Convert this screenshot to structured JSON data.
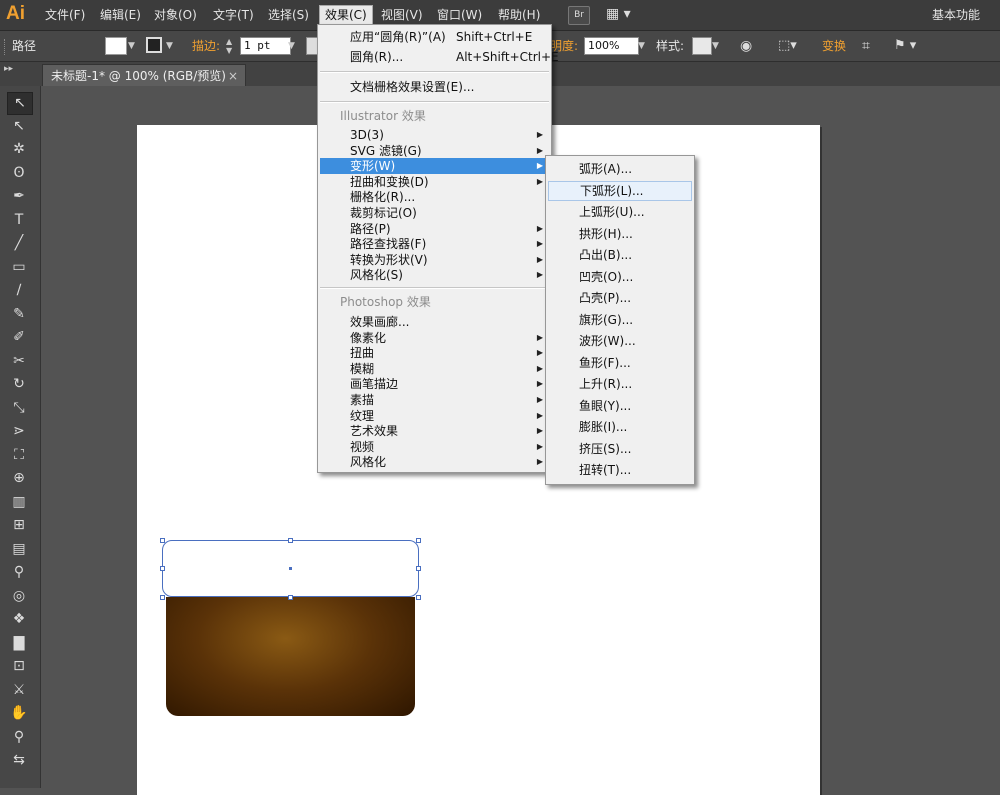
{
  "app": {
    "logo": "Ai",
    "workspace": "基本功能",
    "bridge_label": "Br",
    "layout_icon": "arrange-documents-icon"
  },
  "menubar": {
    "items": [
      {
        "label": "文件(F)"
      },
      {
        "label": "编辑(E)"
      },
      {
        "label": "对象(O)"
      },
      {
        "label": "文字(T)"
      },
      {
        "label": "选择(S)"
      },
      {
        "label": "效果(C)",
        "active": true
      },
      {
        "label": "视图(V)"
      },
      {
        "label": "窗口(W)"
      },
      {
        "label": "帮助(H)"
      }
    ]
  },
  "controlbar": {
    "selection_type": "路径",
    "stroke_label": "描边:",
    "stroke_weight": "1 pt",
    "opacity_label": "明度:",
    "opacity_value": "100%",
    "style_label": "样式:",
    "transform_label": "变换",
    "colors": {
      "fill": "#ffffff",
      "stroke": "#222222",
      "accent_label": "#f0a030"
    }
  },
  "document": {
    "tab_title": "未标题-1* @ 100% (RGB/预览)",
    "tab_close": "×"
  },
  "toolbox": {
    "tools": [
      {
        "name": "selection-tool",
        "glyph": "↖",
        "selected": true
      },
      {
        "name": "direct-selection-tool",
        "glyph": "↖"
      },
      {
        "name": "magic-wand-tool",
        "glyph": "✲"
      },
      {
        "name": "lasso-tool",
        "glyph": "ʘ"
      },
      {
        "name": "pen-tool",
        "glyph": "✒"
      },
      {
        "name": "type-tool",
        "glyph": "T"
      },
      {
        "name": "line-tool",
        "glyph": "╱"
      },
      {
        "name": "rectangle-tool",
        "glyph": "▭"
      },
      {
        "name": "paintbrush-tool",
        "glyph": "∕"
      },
      {
        "name": "pencil-tool",
        "glyph": "✎"
      },
      {
        "name": "blob-brush-tool",
        "glyph": "✐"
      },
      {
        "name": "scissors-tool",
        "glyph": "✂"
      },
      {
        "name": "rotate-tool",
        "glyph": "↻"
      },
      {
        "name": "scale-tool",
        "glyph": "⤡"
      },
      {
        "name": "width-tool",
        "glyph": "⋗"
      },
      {
        "name": "free-transform-tool",
        "glyph": "⛶"
      },
      {
        "name": "shape-builder-tool",
        "glyph": "⊕"
      },
      {
        "name": "perspective-grid-tool",
        "glyph": "▥"
      },
      {
        "name": "mesh-tool",
        "glyph": "⊞"
      },
      {
        "name": "gradient-tool",
        "glyph": "▤"
      },
      {
        "name": "eyedropper-tool",
        "glyph": "⚲"
      },
      {
        "name": "blend-tool",
        "glyph": "◎"
      },
      {
        "name": "symbol-sprayer-tool",
        "glyph": "❖"
      },
      {
        "name": "column-graph-tool",
        "glyph": "▇"
      },
      {
        "name": "artboard-tool",
        "glyph": "⊡"
      },
      {
        "name": "slice-tool",
        "glyph": "⚔"
      },
      {
        "name": "hand-tool",
        "glyph": "✋"
      },
      {
        "name": "zoom-tool",
        "glyph": "⚲"
      },
      {
        "name": "fill-stroke-swap-icon",
        "glyph": "⇆"
      }
    ]
  },
  "effects_menu": {
    "apply_last": "应用“圆角(R)”(A)",
    "apply_last_shortcut": "Shift+Ctrl+E",
    "last_effect": "圆角(R)...",
    "last_effect_shortcut": "Alt+Shift+Ctrl+E",
    "raster_settings": "文档栅格效果设置(E)...",
    "illustrator_title": "Illustrator 效果",
    "illustrator_items": [
      {
        "label": "3D(3)",
        "submenu": true
      },
      {
        "label": "SVG 滤镜(G)",
        "submenu": true
      },
      {
        "label": "变形(W)",
        "submenu": true,
        "highlight": true
      },
      {
        "label": "扭曲和变换(D)",
        "submenu": true
      },
      {
        "label": "栅格化(R)..."
      },
      {
        "label": "裁剪标记(O)"
      },
      {
        "label": "路径(P)",
        "submenu": true
      },
      {
        "label": "路径查找器(F)",
        "submenu": true
      },
      {
        "label": "转换为形状(V)",
        "submenu": true
      },
      {
        "label": "风格化(S)",
        "submenu": true
      }
    ],
    "photoshop_title": "Photoshop 效果",
    "photoshop_items": [
      {
        "label": "效果画廊..."
      },
      {
        "label": "像素化",
        "submenu": true
      },
      {
        "label": "扭曲",
        "submenu": true
      },
      {
        "label": "模糊",
        "submenu": true
      },
      {
        "label": "画笔描边",
        "submenu": true
      },
      {
        "label": "素描",
        "submenu": true
      },
      {
        "label": "纹理",
        "submenu": true
      },
      {
        "label": "艺术效果",
        "submenu": true
      },
      {
        "label": "视频",
        "submenu": true
      },
      {
        "label": "风格化",
        "submenu": true
      }
    ]
  },
  "warp_menu": {
    "items": [
      {
        "label": "弧形(A)..."
      },
      {
        "label": "下弧形(L)...",
        "hover": true
      },
      {
        "label": "上弧形(U)..."
      },
      {
        "label": "拱形(H)..."
      },
      {
        "label": "凸出(B)..."
      },
      {
        "label": "凹壳(O)..."
      },
      {
        "label": "凸壳(P)..."
      },
      {
        "label": "旗形(G)..."
      },
      {
        "label": "波形(W)..."
      },
      {
        "label": "鱼形(F)..."
      },
      {
        "label": "上升(R)..."
      },
      {
        "label": "鱼眼(Y)..."
      },
      {
        "label": "膨胀(I)..."
      },
      {
        "label": "挤压(S)..."
      },
      {
        "label": "扭转(T)..."
      }
    ]
  },
  "artwork": {
    "colors": {
      "selection": "#4a6fc0",
      "gradient_inner": "#8a5a14",
      "gradient_outer": "#2e1600"
    }
  }
}
